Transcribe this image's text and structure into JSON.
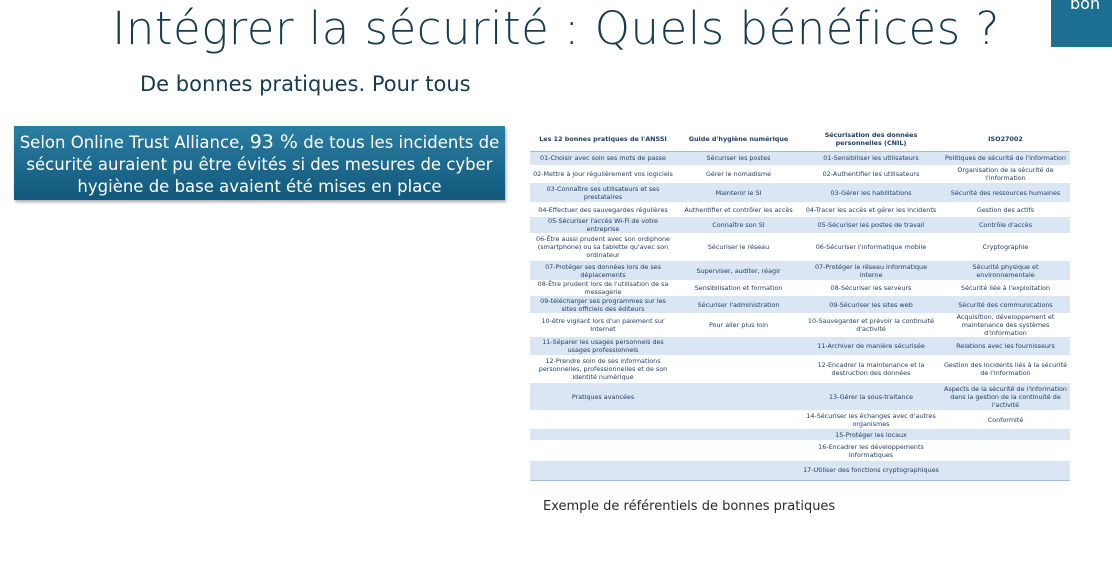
{
  "slide": {
    "title": "Intégrer la sécurité : Quels bénéfices ?",
    "subtitle": "De bonnes pratiques. Pour tous",
    "corner_tab_text": "bon",
    "callout": {
      "before": "Selon Online Trust Alliance, ",
      "highlight": "93 %",
      "after": " de tous les incidents de sécurité auraient pu être évités si des mesures de cyber hygiène de base avaient été mises en place"
    },
    "caption": "Exemple de référentiels de bonnes pratiques"
  },
  "table": {
    "headers": [
      "Les 12 bonnes pratiques de l'ANSSI",
      "Guide d'hygiène numérique",
      "Sécurisation des données personnelles (CNIL)",
      "ISO27002"
    ],
    "rows": [
      [
        "01-Choisir avec soin ses mots de passe",
        "Sécuriser les postes",
        "01-Sensibiliser les utilisateurs",
        "Politiques de sécurité de l'information"
      ],
      [
        "02-Mettre à jour régulièrement vos logiciels",
        "Gérer le nomadisme",
        "02-Authentifier les utilisateurs",
        "Organisation de la sécurité de l'information"
      ],
      [
        "03-Connaître ses utilisateurs et ses prestataires",
        "Maintenir le SI",
        "03-Gérer les habilitations",
        "Sécurité des ressources humaines"
      ],
      [
        "04-Effectuer des sauvegardes régulières",
        "Authentifier et contrôler les accès",
        "04-Tracer les accès et gérer les incidents",
        "Gestion des actifs"
      ],
      [
        "05-Sécuriser l'accès Wi-Fi de votre entreprise",
        "Connaître son SI",
        "05-Sécuriser les postes de travail",
        "Contrôle d'accès"
      ],
      [
        "06-Être aussi prudent avec son ordiphone (smartphone) ou sa tablette qu'avec son ordinateur",
        "Sécuriser le réseau",
        "06-Sécuriser l'informatique mobile",
        "Cryptographie"
      ],
      [
        "07-Protéger ses données lors de ses déplacements",
        "Superviser, auditer, réagir",
        "07-Protéger le réseau informatique interne",
        "Sécurité physique et environnementale"
      ],
      [
        "08-Être prudent lors de l'utilisation de sa messagerie",
        "Sensibilisation et formation",
        "08-Sécuriser les serveurs",
        "Sécurité liée à l'exploitation"
      ],
      [
        "09-télécharger ses programmes sur les sites officiels des éditeurs",
        "Sécuriser l'administration",
        "09-Sécuriser les sites web",
        "Sécurité des communications"
      ],
      [
        "10-être vigilant lors d'un paiement sur Internet",
        "Pour aller plus loin",
        "10-Sauvegarder et prévoir la continuité d'activité",
        "Acquisition, développement et maintenance des systèmes d'information"
      ],
      [
        "11-Séparer les usages personnels des usages professionnels",
        "",
        "11-Archiver de manière sécurisée",
        "Relations avec les fournisseurs"
      ],
      [
        "12-Prendre soin de ses informations personnelles, professionnelles et de son identité numérique",
        "",
        "12-Encadrer la maintenance et la destruction des données",
        "Gestion des incidents liés à la sécurité de l'information"
      ],
      [
        "Pratiques avancées",
        "",
        "13-Gérer la sous-traitance",
        "Aspects de la sécurité de l'information dans la gestion de la continuité de l'activité"
      ],
      [
        "",
        "",
        "14-Sécuriser les échanges avec d'autres organismes",
        "Conformité"
      ],
      [
        "",
        "",
        "15-Protéger les locaux",
        ""
      ],
      [
        "",
        "",
        "16-Encadrer les développements informatiques",
        ""
      ],
      [
        "",
        "",
        "17-Utiliser des fonctions cryptographiques",
        ""
      ]
    ]
  }
}
